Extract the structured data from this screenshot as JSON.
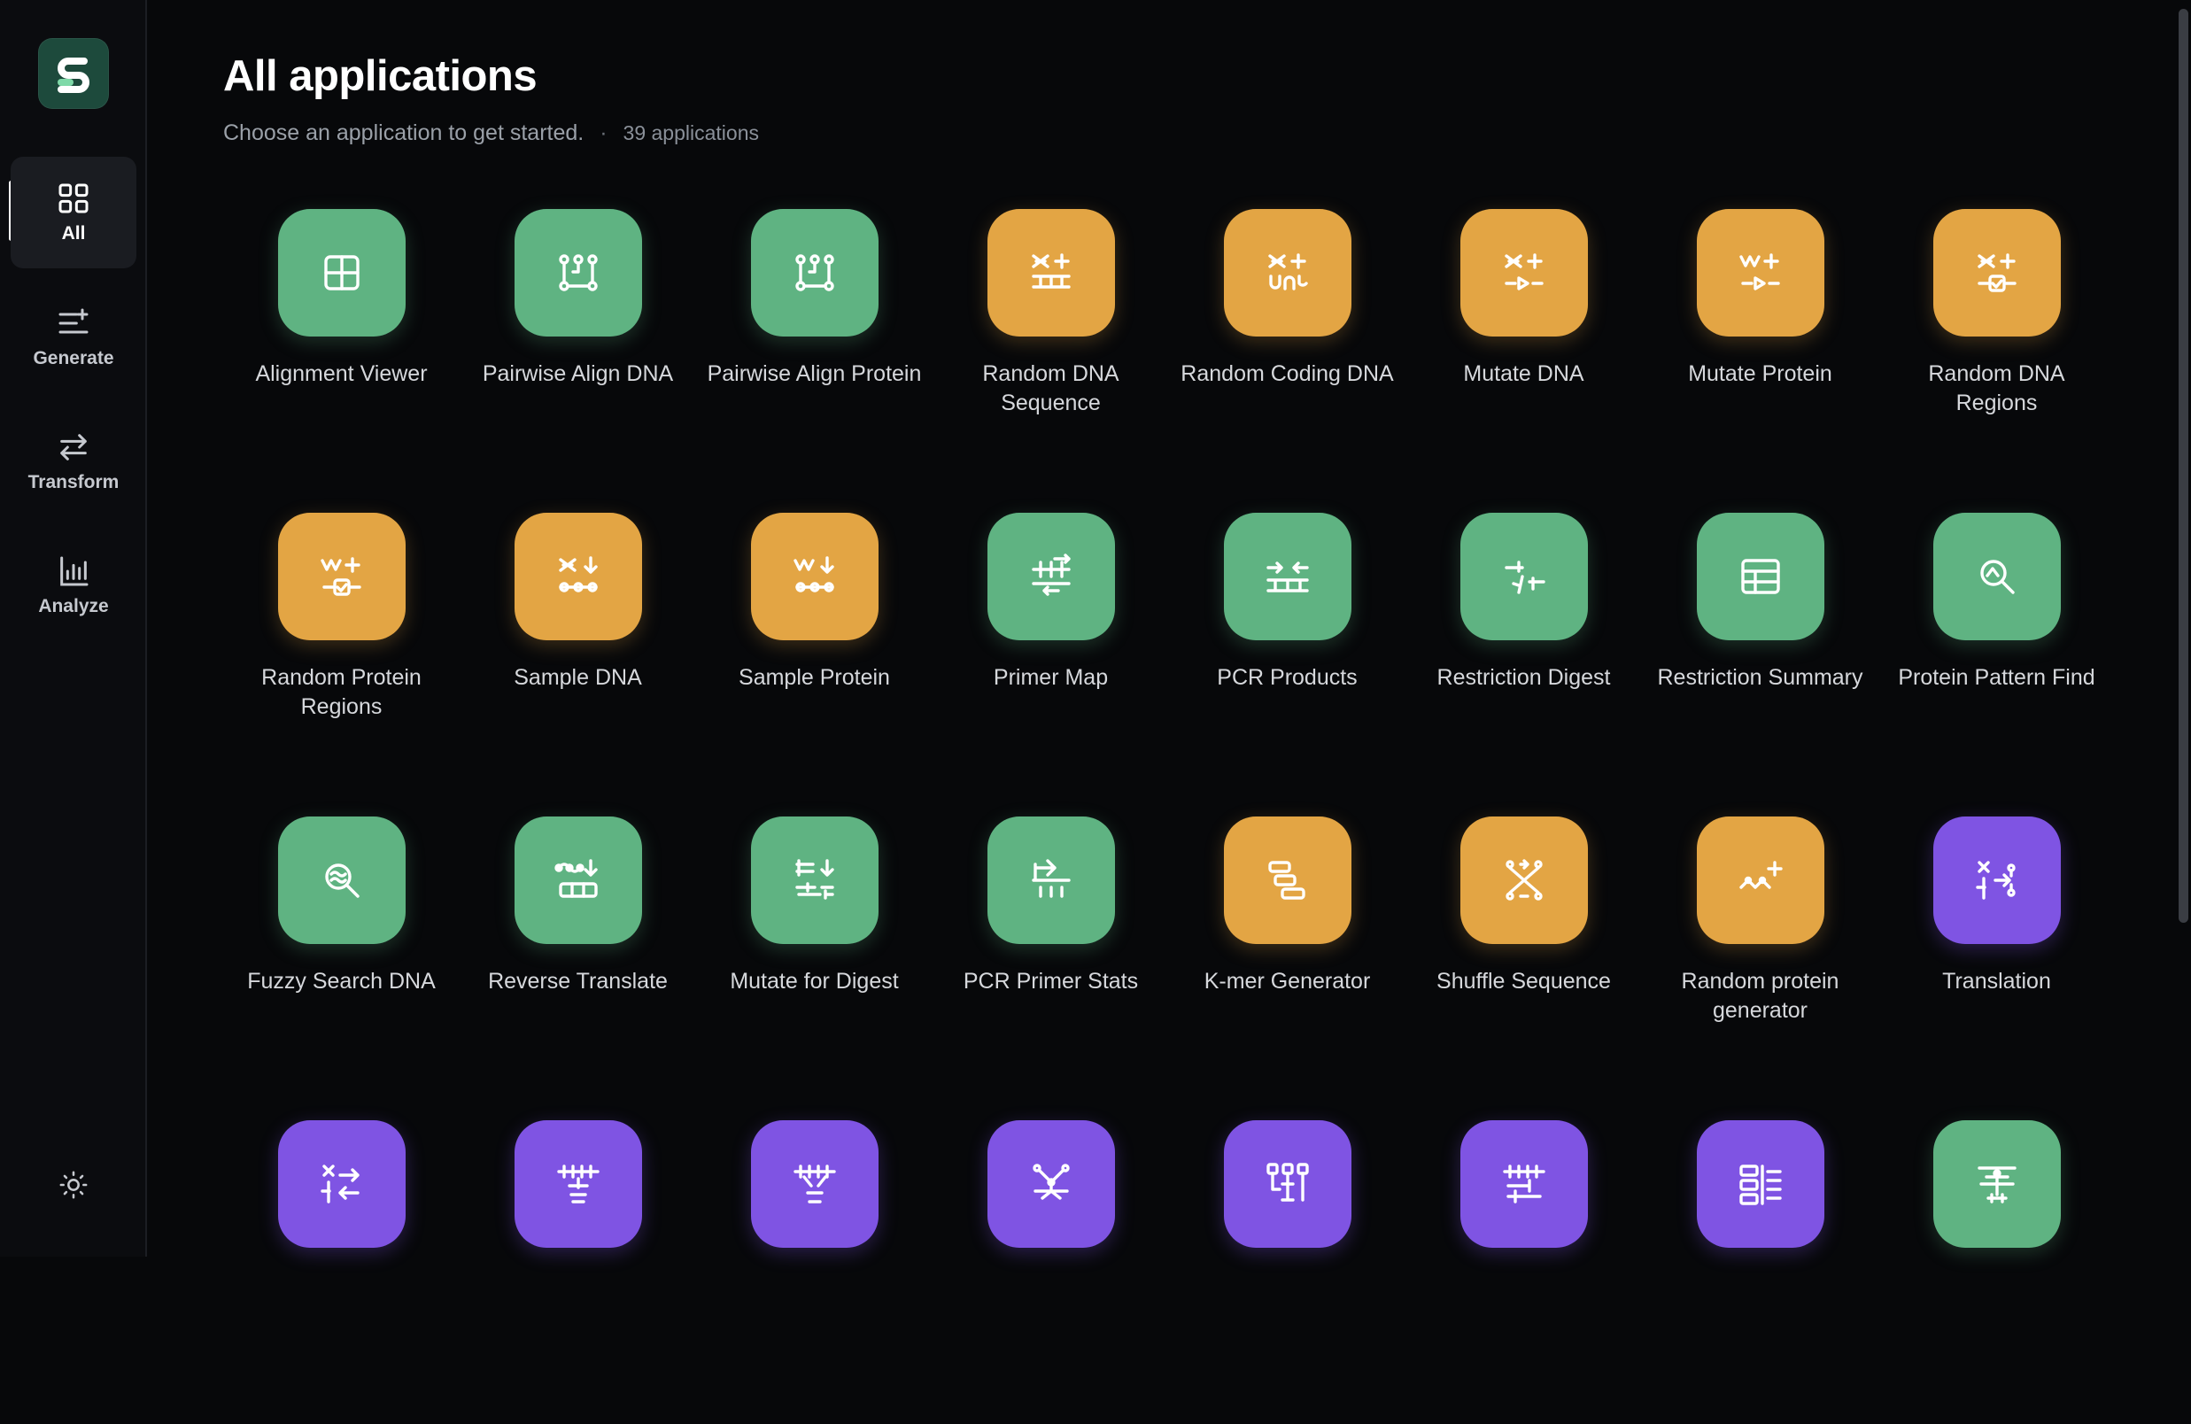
{
  "app": {
    "logo_letter": "S"
  },
  "sidebar": {
    "items": [
      {
        "id": "all",
        "label": "All",
        "icon": "grid-icon",
        "active": true
      },
      {
        "id": "generate",
        "label": "Generate",
        "icon": "list-plus-icon",
        "active": false
      },
      {
        "id": "transform",
        "label": "Transform",
        "icon": "arrows-swap-icon",
        "active": false
      },
      {
        "id": "analyze",
        "label": "Analyze",
        "icon": "bar-chart-icon",
        "active": false
      }
    ],
    "theme_toggle_icon": "sun-icon"
  },
  "header": {
    "title": "All applications",
    "subtitle": "Choose an application to get started.",
    "separator": "·",
    "count": "39 applications"
  },
  "colors": {
    "green": "#5fb382",
    "orange": "#e3a544",
    "purple": "#7f54e3",
    "background": "#07080a"
  },
  "apps": [
    {
      "name": "Alignment Viewer",
      "color": "green",
      "icon": "grid-view"
    },
    {
      "name": "Pairwise Align DNA",
      "color": "green",
      "icon": "align"
    },
    {
      "name": "Pairwise Align Protein",
      "color": "green",
      "icon": "align"
    },
    {
      "name": "Random DNA Sequence",
      "color": "orange",
      "icon": "dna-plus-bars"
    },
    {
      "name": "Random Coding DNA",
      "color": "orange",
      "icon": "dna-plus-wave"
    },
    {
      "name": "Mutate DNA",
      "color": "orange",
      "icon": "dna-plus-arrow"
    },
    {
      "name": "Mutate Protein",
      "color": "orange",
      "icon": "zigzag-plus-arrow"
    },
    {
      "name": "Random DNA Regions",
      "color": "orange",
      "icon": "dna-plus-check"
    },
    {
      "name": "Random Protein Regions",
      "color": "orange",
      "icon": "zigzag-plus-check"
    },
    {
      "name": "Sample DNA",
      "color": "orange",
      "icon": "dna-down-dots"
    },
    {
      "name": "Sample Protein",
      "color": "orange",
      "icon": "zigzag-down-dots"
    },
    {
      "name": "Primer Map",
      "color": "green",
      "icon": "primer-map"
    },
    {
      "name": "PCR Products",
      "color": "green",
      "icon": "pcr-products"
    },
    {
      "name": "Restriction Digest",
      "color": "green",
      "icon": "restriction-digest"
    },
    {
      "name": "Restriction Summary",
      "color": "green",
      "icon": "table"
    },
    {
      "name": "Protein Pattern Find",
      "color": "green",
      "icon": "search"
    },
    {
      "name": "Fuzzy Search DNA",
      "color": "green",
      "icon": "fuzzy-search"
    },
    {
      "name": "Reverse Translate",
      "color": "green",
      "icon": "reverse-translate"
    },
    {
      "name": "Mutate for Digest",
      "color": "green",
      "icon": "mutate-digest"
    },
    {
      "name": "PCR Primer Stats",
      "color": "green",
      "icon": "primer-stats"
    },
    {
      "name": "K-mer Generator",
      "color": "orange",
      "icon": "kmer"
    },
    {
      "name": "Shuffle Sequence",
      "color": "orange",
      "icon": "shuffle"
    },
    {
      "name": "Random protein generator",
      "color": "orange",
      "icon": "wave-plus"
    },
    {
      "name": "Translation",
      "color": "purple",
      "icon": "translate"
    },
    {
      "name": "",
      "color": "purple",
      "icon": "split-arrows"
    },
    {
      "name": "",
      "color": "purple",
      "icon": "comb-down"
    },
    {
      "name": "",
      "color": "purple",
      "icon": "comb-up"
    },
    {
      "name": "",
      "color": "purple",
      "icon": "cross-nodes"
    },
    {
      "name": "",
      "color": "purple",
      "icon": "bars-stack"
    },
    {
      "name": "",
      "color": "purple",
      "icon": "ladder-stack"
    },
    {
      "name": "",
      "color": "purple",
      "icon": "cut-list"
    },
    {
      "name": "",
      "color": "green",
      "icon": "balance"
    }
  ]
}
